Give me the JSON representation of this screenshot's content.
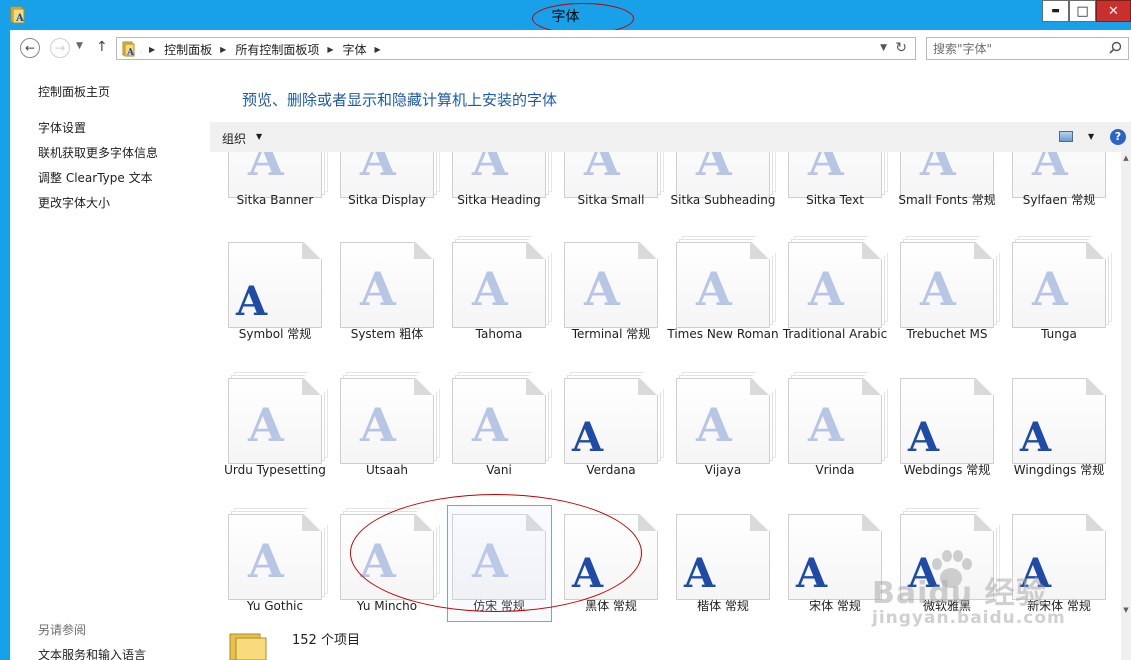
{
  "window": {
    "title": "字体",
    "controls": {
      "minimize": "▬",
      "maximize": "□",
      "close": "✕"
    }
  },
  "address_bar": {
    "breadcrumbs": [
      "控制面板",
      "所有控制面板项",
      "字体"
    ],
    "search_placeholder": "搜索\"字体\""
  },
  "sidebar": {
    "home": "控制面板主页",
    "links": [
      "字体设置",
      "联机获取更多字体信息",
      "调整 ClearType 文本",
      "更改字体大小"
    ],
    "see_also_header": "另请参阅",
    "see_also": [
      "文本服务和输入语言"
    ]
  },
  "main": {
    "heading": "预览、删除或者显示和隐藏计算机上安装的字体",
    "organize": "组织",
    "help": "?"
  },
  "fonts": [
    {
      "label": "Sitka Banner",
      "style": "faint",
      "stack": true
    },
    {
      "label": "Sitka Display",
      "style": "faint",
      "stack": true
    },
    {
      "label": "Sitka Heading",
      "style": "faint",
      "stack": true
    },
    {
      "label": "Sitka Small",
      "style": "faint",
      "stack": true
    },
    {
      "label": "Sitka Subheading",
      "style": "faint",
      "stack": true
    },
    {
      "label": "Sitka Text",
      "style": "faint",
      "stack": true
    },
    {
      "label": "Small Fonts 常规",
      "style": "faint",
      "stack": false
    },
    {
      "label": "Sylfaen 常规",
      "style": "faint",
      "stack": false
    },
    {
      "label": "Symbol 常规",
      "style": "strong",
      "stack": false
    },
    {
      "label": "System 粗体",
      "style": "faint",
      "stack": false
    },
    {
      "label": "Tahoma",
      "style": "faint",
      "stack": true
    },
    {
      "label": "Terminal 常规",
      "style": "faint",
      "stack": false
    },
    {
      "label": "Times New Roman",
      "style": "faint",
      "stack": true
    },
    {
      "label": "Traditional Arabic",
      "style": "faint",
      "stack": true
    },
    {
      "label": "Trebuchet MS",
      "style": "faint",
      "stack": true
    },
    {
      "label": "Tunga",
      "style": "faint",
      "stack": true
    },
    {
      "label": "Urdu Typesetting",
      "style": "faint",
      "stack": true
    },
    {
      "label": "Utsaah",
      "style": "faint",
      "stack": true
    },
    {
      "label": "Vani",
      "style": "faint",
      "stack": true
    },
    {
      "label": "Verdana",
      "style": "strong",
      "stack": true
    },
    {
      "label": "Vijaya",
      "style": "faint",
      "stack": true
    },
    {
      "label": "Vrinda",
      "style": "faint",
      "stack": true
    },
    {
      "label": "Webdings 常规",
      "style": "strong",
      "stack": false
    },
    {
      "label": "Wingdings 常规",
      "style": "strong",
      "stack": false
    },
    {
      "label": "Yu Gothic",
      "style": "faint",
      "stack": true
    },
    {
      "label": "Yu Mincho",
      "style": "faint",
      "stack": true
    },
    {
      "label": "仿宋 常规",
      "style": "faint",
      "stack": false
    },
    {
      "label": "黑体 常规",
      "style": "strong",
      "stack": false
    },
    {
      "label": "楷体 常规",
      "style": "strong",
      "stack": false
    },
    {
      "label": "宋体 常规",
      "style": "strong",
      "stack": false
    },
    {
      "label": "微软雅黑",
      "style": "strong",
      "stack": true
    },
    {
      "label": "新宋体 常规",
      "style": "strong",
      "stack": false
    }
  ],
  "status": {
    "count": "152 个项目"
  },
  "watermark": {
    "main": "Baidu 经验",
    "sub": "jingyan.baidu.com"
  },
  "colors": {
    "titlebar": "#18a0e8",
    "heading": "#1e5aa8",
    "annotation": "#c00000",
    "font_glyph": "#1f4ba8"
  }
}
